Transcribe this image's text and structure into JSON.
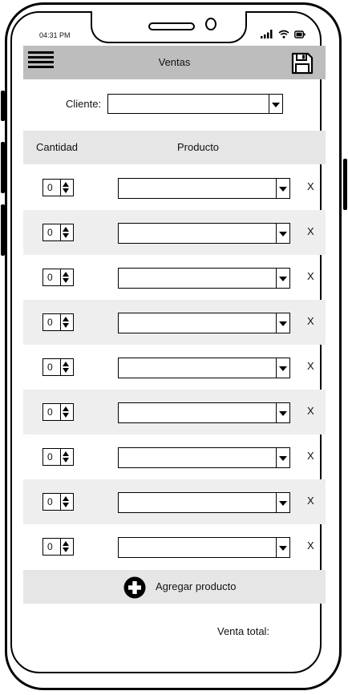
{
  "status": {
    "time": "04:31 PM"
  },
  "header": {
    "title": "Ventas"
  },
  "cliente": {
    "label": "Cliente:",
    "value": ""
  },
  "table": {
    "col_quantity": "Cantidad",
    "col_product": "Producto",
    "rows": [
      {
        "quantity": "0",
        "product": "",
        "remove": "X"
      },
      {
        "quantity": "0",
        "product": "",
        "remove": "X"
      },
      {
        "quantity": "0",
        "product": "",
        "remove": "X"
      },
      {
        "quantity": "0",
        "product": "",
        "remove": "X"
      },
      {
        "quantity": "0",
        "product": "",
        "remove": "X"
      },
      {
        "quantity": "0",
        "product": "",
        "remove": "X"
      },
      {
        "quantity": "0",
        "product": "",
        "remove": "X"
      },
      {
        "quantity": "0",
        "product": "",
        "remove": "X"
      },
      {
        "quantity": "0",
        "product": "",
        "remove": "X"
      }
    ]
  },
  "add_product": {
    "label": "Agregar producto"
  },
  "footer": {
    "total_label": "Venta total:"
  },
  "icons": {
    "menu": "hamburger-menu-icon",
    "save": "floppy-disk-icon",
    "add": "plus-circle-icon",
    "signal": "signal-icon",
    "wifi": "wifi-icon",
    "battery": "battery-icon"
  },
  "colors": {
    "header_bg": "#bdbdbd",
    "band_bg": "#e6e6e6",
    "row_alt_bg": "#eeeeee"
  }
}
